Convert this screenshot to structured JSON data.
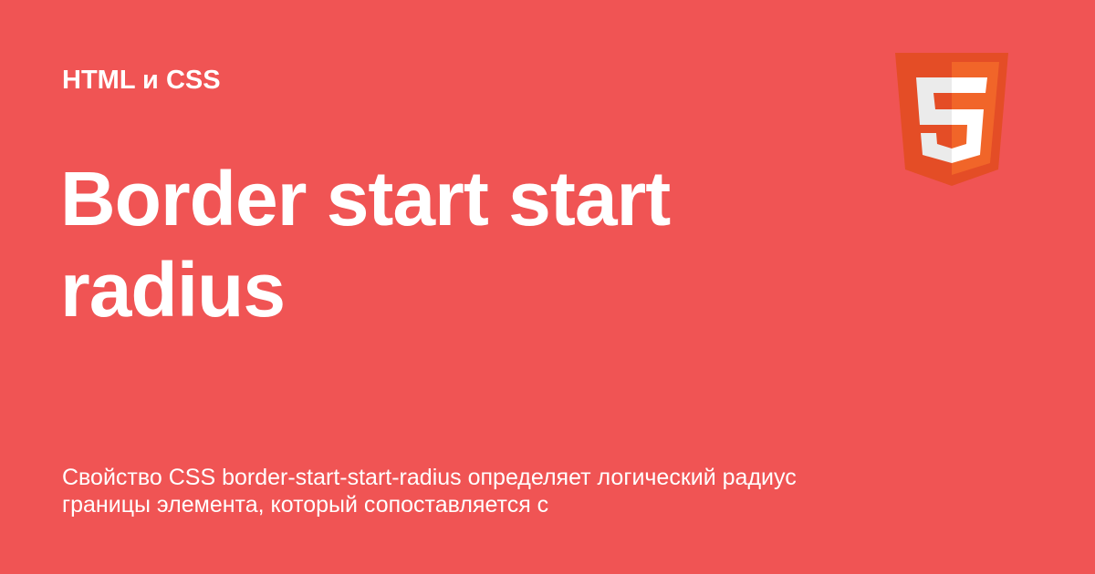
{
  "card": {
    "category": "HTML и CSS",
    "title": "Border start start radius",
    "description": "Свойство CSS border-start-start-radius определяет логический радиус границы элемента, который сопоставляется с"
  },
  "logo": {
    "icon": "html5-icon",
    "colors": {
      "outer": "#e44d26",
      "inner": "#f16529",
      "glyph_light": "#ebebeb",
      "glyph_white": "#ffffff"
    }
  },
  "colors": {
    "background": "#f05454",
    "text": "#ffffff"
  }
}
